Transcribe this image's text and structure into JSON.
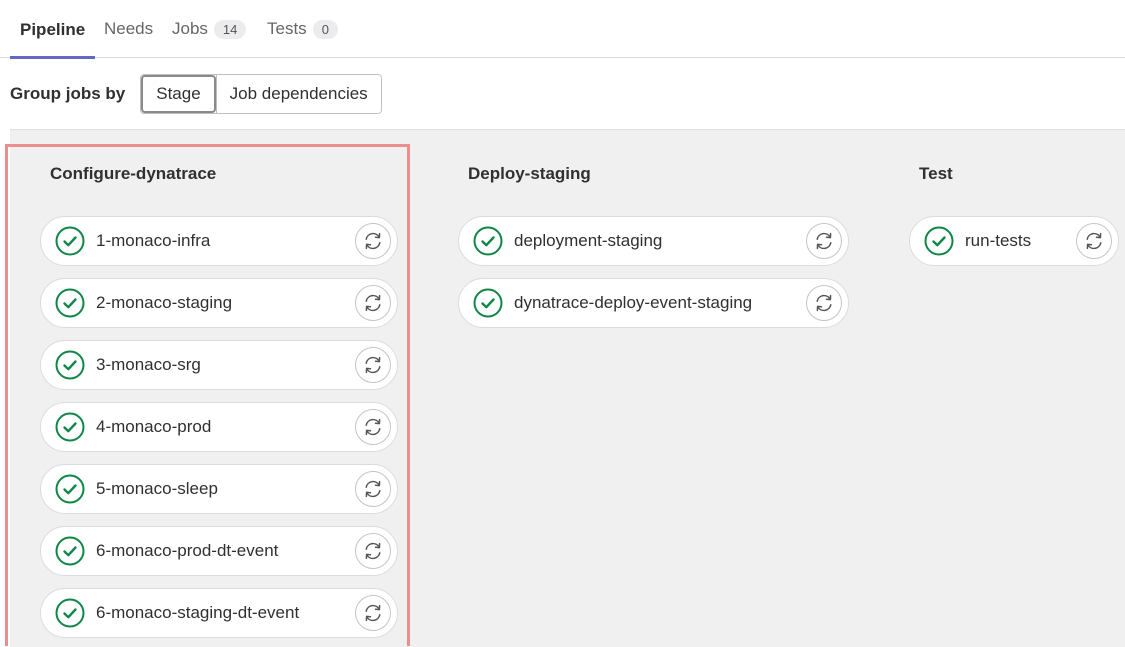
{
  "tabs": [
    {
      "label": "Pipeline"
    },
    {
      "label": "Needs"
    },
    {
      "label": "Jobs",
      "count": "14"
    },
    {
      "label": "Tests",
      "count": "0"
    }
  ],
  "group_by": {
    "label": "Group jobs by",
    "options": [
      "Stage",
      "Job dependencies"
    ],
    "selected": "Stage"
  },
  "stages": [
    {
      "title": "Configure-dynatrace",
      "jobs": [
        {
          "name": "1-monaco-infra",
          "status": "success"
        },
        {
          "name": "2-monaco-staging",
          "status": "success"
        },
        {
          "name": "3-monaco-srg",
          "status": "success"
        },
        {
          "name": "4-monaco-prod",
          "status": "success"
        },
        {
          "name": "5-monaco-sleep",
          "status": "success"
        },
        {
          "name": "6-monaco-prod-dt-event",
          "status": "success"
        },
        {
          "name": "6-monaco-staging-dt-event",
          "status": "success"
        }
      ]
    },
    {
      "title": "Deploy-staging",
      "jobs": [
        {
          "name": "deployment-staging",
          "status": "success"
        },
        {
          "name": "dynatrace-deploy-event-staging",
          "status": "success"
        }
      ]
    },
    {
      "title": "Test",
      "jobs": [
        {
          "name": "run-tests",
          "status": "success"
        }
      ]
    }
  ],
  "colors": {
    "success": "#108548",
    "accent": "#6666c4",
    "highlight": "#ec8e8e"
  }
}
